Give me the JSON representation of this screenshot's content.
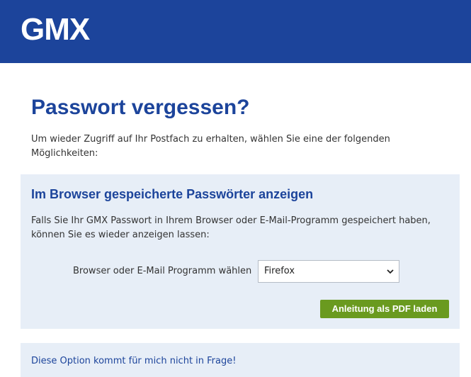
{
  "header": {
    "logo_text": "GMX",
    "bg_color": "#1c449b"
  },
  "page": {
    "title": "Passwort vergessen?",
    "intro": "Um wieder Zugriff auf Ihr Postfach zu erhalten, wählen Sie eine der folgenden Möglichkeiten:"
  },
  "browser_section": {
    "title": "Im Browser gespeicherte Passwörter anzeigen",
    "text": "Falls Sie Ihr GMX Passwort in Ihrem Browser oder E-Mail-Programm gespeichert haben, können Sie es wieder anzeigen lassen:",
    "select_label": "Browser oder E-Mail Programm wählen",
    "select_value": "Firefox",
    "button_label": "Anleitung als PDF laden",
    "button_color": "#6a9a1f",
    "panel_color": "#e7eef7"
  },
  "other_option": {
    "link_text": "Diese Option kommt für mich nicht in Frage!"
  },
  "icons": {
    "select_arrow": "chevron-down-icon"
  }
}
